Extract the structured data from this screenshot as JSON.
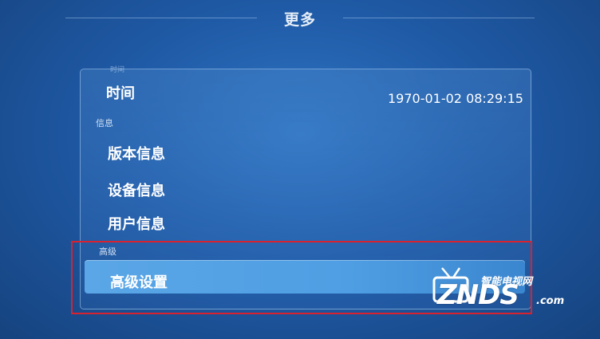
{
  "header": {
    "title": "更多"
  },
  "panel": {
    "top_hint": "时间",
    "time": {
      "label": "时间",
      "value": "1970-01-02 08:29:15"
    },
    "info_section": {
      "title": "信息",
      "items": [
        {
          "label": "版本信息"
        },
        {
          "label": "设备信息"
        },
        {
          "label": "用户信息"
        }
      ]
    },
    "advanced_section": {
      "title": "高级",
      "items": [
        {
          "label": "高级设置",
          "selected": true
        }
      ]
    }
  },
  "watermark": {
    "cn": "智能电视网",
    "main": "ZNDS",
    "suffix": ".com"
  },
  "colors": {
    "highlight": "#4f9ee3",
    "annotation_box": "#d8222f",
    "background": "#1f5aa6"
  }
}
